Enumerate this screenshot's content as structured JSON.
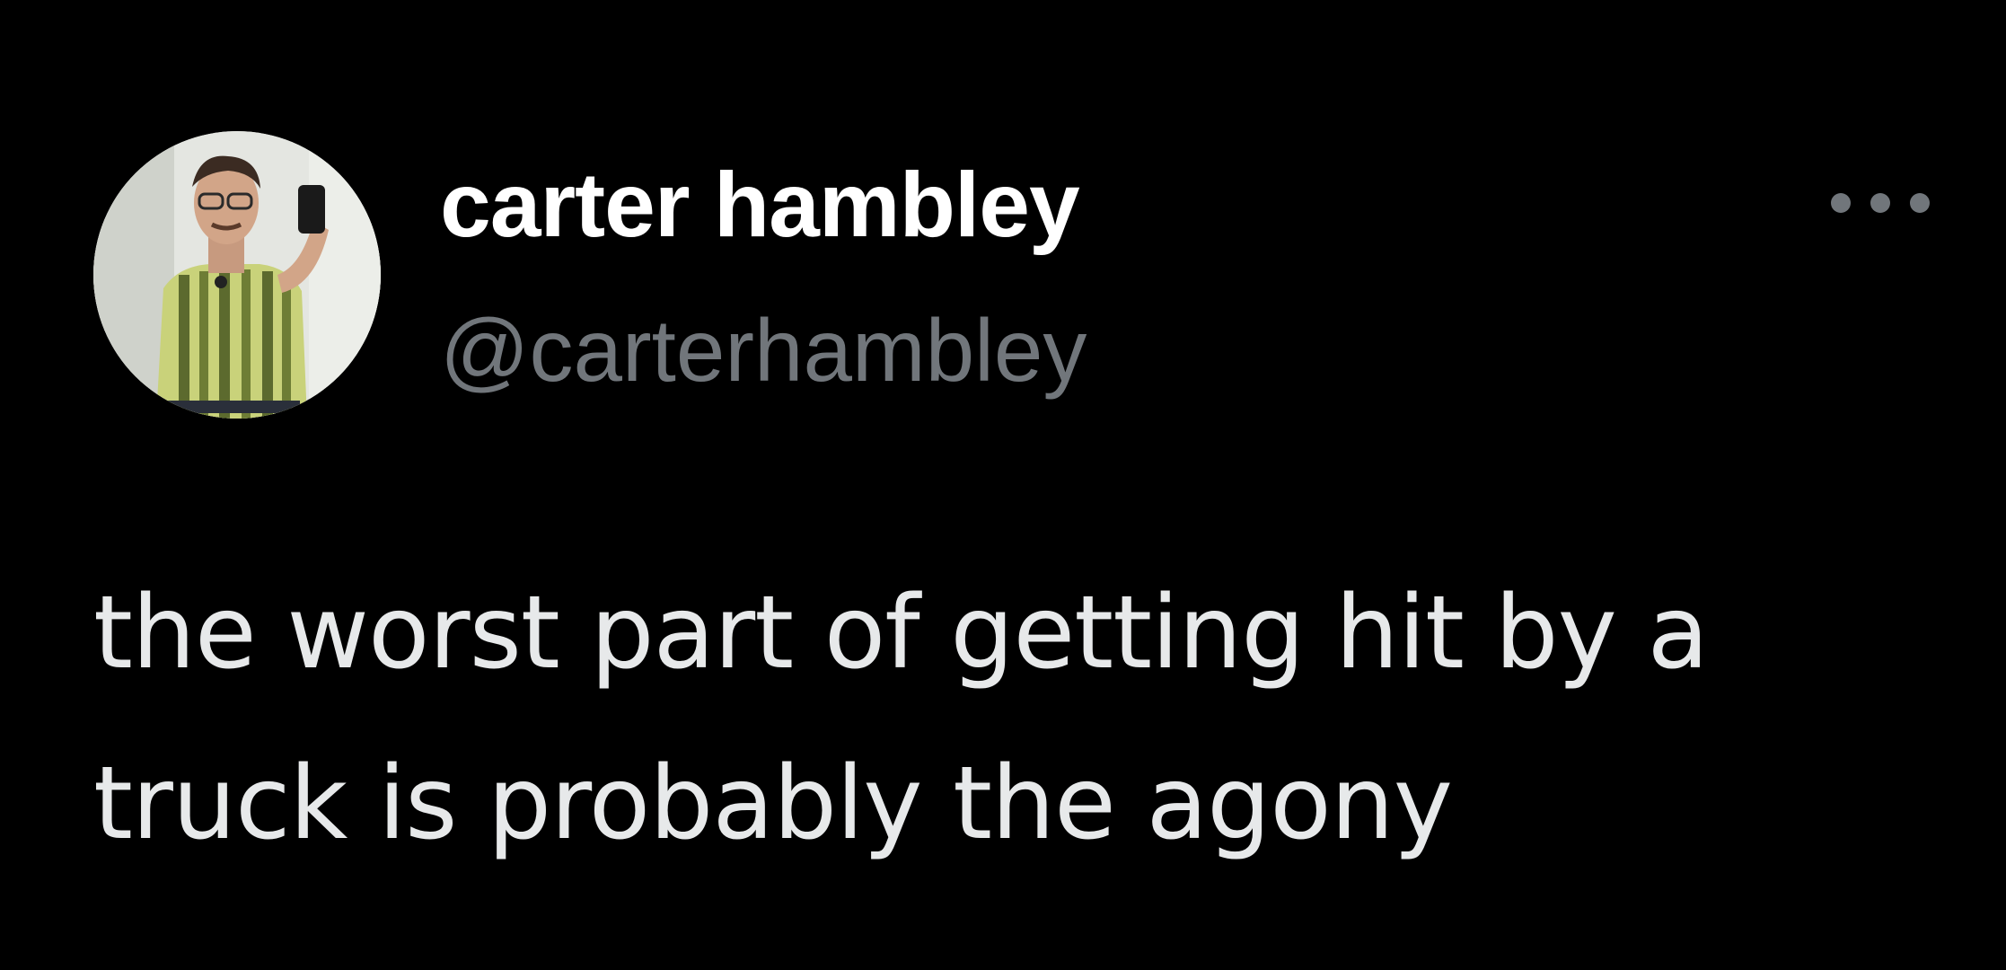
{
  "author": {
    "display_name": "carter hambley",
    "handle": "@carterhambley",
    "avatar_icon": "profile-photo"
  },
  "more_icon": "ellipsis-icon",
  "tweet": {
    "lines": [
      "the worst part of getting hit by a",
      "truck is probably the agony"
    ]
  },
  "colors": {
    "background": "#000000",
    "display_name": "#ffffff",
    "handle": "#71767b",
    "body_text": "#e7e9ea",
    "more_dots": "#71767b"
  }
}
